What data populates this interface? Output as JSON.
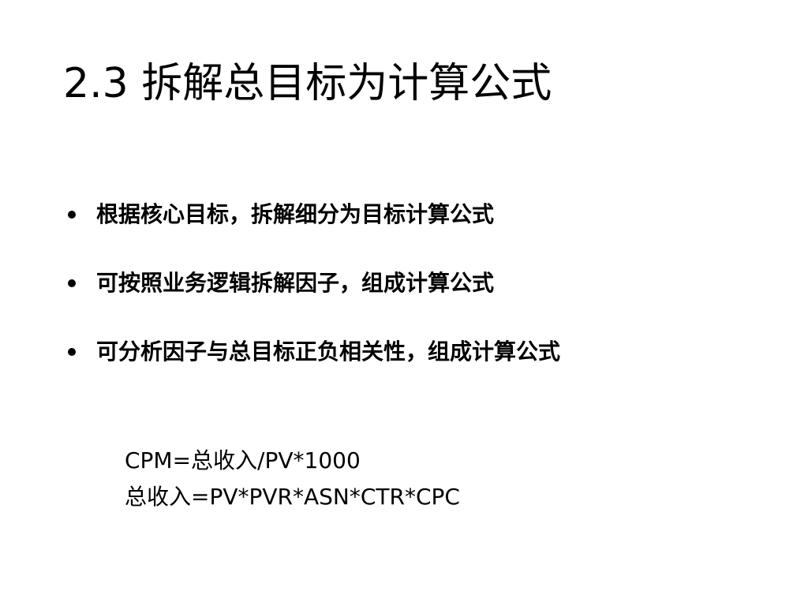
{
  "slide": {
    "title": "2.3 拆解总目标为计算公式",
    "bullets": [
      "根据核心目标，拆解细分为目标计算公式",
      "可按照业务逻辑拆解因子，组成计算公式",
      "可分析因子与总目标正负相关性，组成计算公式"
    ],
    "formulas": [
      "CPM=总收入/PV*1000",
      "总收入=PV*PVR*ASN*CTR*CPC"
    ]
  }
}
